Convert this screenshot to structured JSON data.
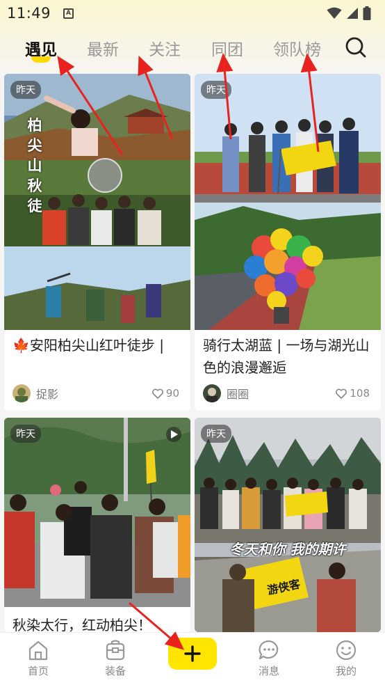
{
  "status_bar": {
    "time": "11:49",
    "a_icon": "A"
  },
  "tabs": [
    {
      "label": "遇见",
      "active": true
    },
    {
      "label": "最新",
      "active": false
    },
    {
      "label": "关注",
      "active": false
    },
    {
      "label": "同团",
      "active": false
    },
    {
      "label": "领队榜",
      "active": false
    }
  ],
  "feed": [
    {
      "badge": "昨天",
      "image_text": [
        "柏",
        "尖",
        "山",
        "秋",
        "徒"
      ],
      "title": "🍁安阳柏尖山红叶徒步 |",
      "author": "捉影",
      "likes": "90"
    },
    {
      "badge": "昨天",
      "title": "骑行太湖蓝 | 一场与湖光山色的浪漫邂逅",
      "author": "圈圈",
      "likes": "108"
    },
    {
      "badge": "昨天",
      "title": "秋染太行，红动柏尖！"
    },
    {
      "badge": "昨天",
      "image_caption": "冬天和你 我的期许",
      "flag_text": "游侠客"
    }
  ],
  "bottom_nav": {
    "home": "首页",
    "gear": "装备",
    "messages": "消息",
    "mine": "我的"
  },
  "colors": {
    "accent": "#ffe500",
    "annotation_arrow": "#e8231f"
  }
}
